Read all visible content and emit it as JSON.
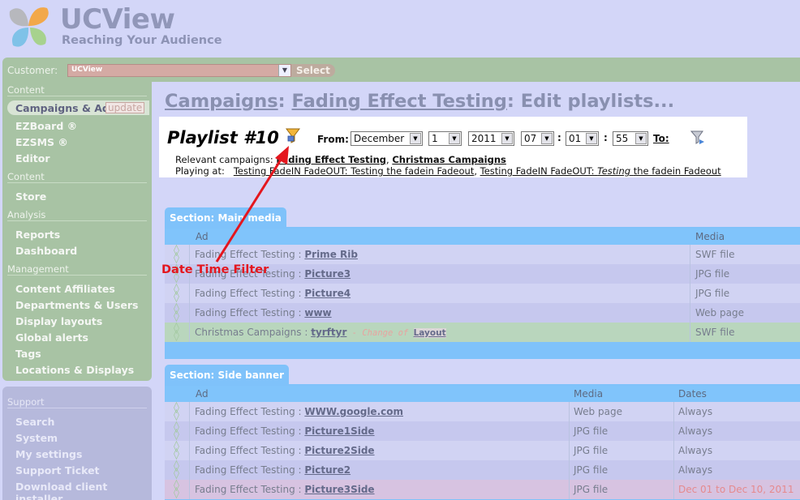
{
  "brand": {
    "name": "UCView",
    "tagline": "Reaching Your Audience"
  },
  "customer": {
    "label": "Customer:",
    "value": "UCView",
    "select_label": "Select"
  },
  "sidebar": {
    "sections": [
      {
        "title": "Content",
        "items": [
          "Campaigns & Ads",
          "EZBoard ®",
          "EZSMS ®",
          "Editor"
        ]
      },
      {
        "title": "Content",
        "items": [
          "Store"
        ]
      },
      {
        "title": "Analysis",
        "items": [
          "Reports",
          "Dashboard"
        ]
      },
      {
        "title": "Management",
        "items": [
          "Content Affiliates",
          "Departments & Users",
          "Display layouts",
          "Global alerts",
          "Tags",
          "Locations & Displays"
        ]
      }
    ],
    "update_badge": "update",
    "support": {
      "title": "Support",
      "items": [
        "Search",
        "System",
        "My settings",
        "Support Ticket",
        "Download client installer"
      ]
    }
  },
  "page_title": {
    "part1": "Campaigns",
    "sep1": ": ",
    "part2": "Fading Effect Testing",
    "sep2": ": ",
    "part3": "Edit playlists..."
  },
  "playlist": {
    "title": "Playlist #10",
    "from_label": "From:",
    "month": "December",
    "day": "1",
    "year": "2011",
    "hour": "07",
    "minute": "01",
    "second": "55",
    "colon": ":",
    "to_label": "To:",
    "relevant_label": "Relevant campaigns:",
    "relevant_1": "Fading Effect Testing",
    "relevant_sep": ",",
    "relevant_2": "Christmas Campaigns",
    "playing_label": "Playing at:",
    "playing_1": "Testing FadeIN FadeOUT: Testing the fadein Fadeout",
    "playing_sep": ",",
    "playing_2_link": "Testing FadeIN FadeOUT:",
    "playing_2_italic": "Testing",
    "playing_2_rest": "the fadein Fadeout"
  },
  "annotation": {
    "label": "Date Time Filter",
    "color": "#e4161e"
  },
  "section_main": {
    "title": "Section: Main media",
    "columns": {
      "ad": "Ad",
      "media": "Media"
    },
    "rows": [
      {
        "campaign": "Fading Effect Testing",
        "sep": " : ",
        "ad": "Prime Rib",
        "media": "SWF file"
      },
      {
        "campaign": "Fading Effect Testing",
        "sep": " : ",
        "ad": "Picture3",
        "media": "JPG file"
      },
      {
        "campaign": "Fading Effect Testing",
        "sep": " : ",
        "ad": "Picture4",
        "media": "JPG file"
      },
      {
        "campaign": "Fading Effect Testing",
        "sep": " : ",
        "ad": "www",
        "media": "Web page"
      },
      {
        "campaign": "Christmas Campaigns",
        "sep": " : ",
        "ad": "tyrftyr",
        "note": " - Change of ",
        "note_link": "Layout",
        "media": "SWF file"
      }
    ]
  },
  "section_side": {
    "title": "Section: Side banner",
    "columns": {
      "ad": "Ad",
      "media": "Media",
      "dates": "Dates"
    },
    "rows": [
      {
        "campaign": "Fading Effect Testing",
        "sep": " : ",
        "ad": "WWW.google.com",
        "media": "Web page",
        "dates": "Always"
      },
      {
        "campaign": "Fading Effect Testing",
        "sep": " : ",
        "ad": "Picture1Side",
        "media": "JPG file",
        "dates": "Always"
      },
      {
        "campaign": "Fading Effect Testing",
        "sep": " : ",
        "ad": "Picture2Side",
        "media": "JPG file",
        "dates": "Always"
      },
      {
        "campaign": "Fading Effect Testing",
        "sep": " : ",
        "ad": "Picture2",
        "media": "JPG file",
        "dates": "Always"
      },
      {
        "campaign": "Fading Effect Testing",
        "sep": " : ",
        "ad": "Picture3Side",
        "media": "JPG file",
        "dates": "Dec 01 to Dec 10, 2011"
      }
    ]
  }
}
